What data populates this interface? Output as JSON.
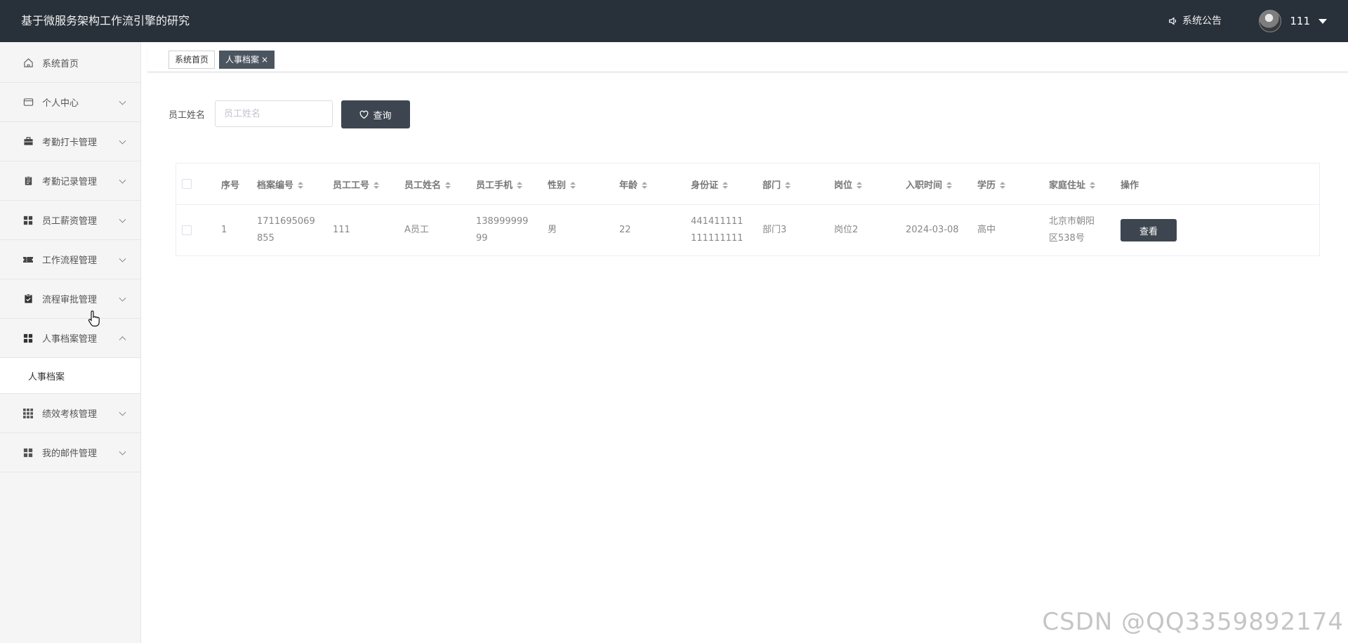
{
  "header": {
    "app_title": "基于微服务架构工作流引擎的研究",
    "notice_label": "系统公告",
    "username": "111"
  },
  "sidebar": {
    "items": [
      {
        "label": "系统首页",
        "icon": "home-icon"
      },
      {
        "label": "个人中心",
        "icon": "wallet-icon"
      },
      {
        "label": "考勤打卡管理",
        "icon": "briefcase-icon"
      },
      {
        "label": "考勤记录管理",
        "icon": "clipboard-icon"
      },
      {
        "label": "员工薪资管理",
        "icon": "grid-icon"
      },
      {
        "label": "工作流程管理",
        "icon": "ticket-icon"
      },
      {
        "label": "流程审批管理",
        "icon": "check-clipboard-icon"
      },
      {
        "label": "人事档案管理",
        "icon": "grid-icon"
      },
      {
        "label": "绩效考核管理",
        "icon": "apps-icon"
      },
      {
        "label": "我的邮件管理",
        "icon": "grid-icon"
      }
    ],
    "subitem": "人事档案"
  },
  "tabs": [
    {
      "label": "系统首页"
    },
    {
      "label": "人事档案",
      "close": "×"
    }
  ],
  "search": {
    "label": "员工姓名",
    "placeholder": "员工姓名",
    "button_label": "查询"
  },
  "table": {
    "headers": [
      "序号",
      "档案编号",
      "员工工号",
      "员工姓名",
      "员工手机",
      "性别",
      "年龄",
      "身份证",
      "部门",
      "岗位",
      "入职时间",
      "学历",
      "家庭住址",
      "操作"
    ],
    "rows": [
      {
        "index": "1",
        "archive_no_line1": "1711695069",
        "archive_no_line2": "855",
        "emp_no": "111",
        "emp_name": "A员工",
        "phone_line1": "138999999",
        "phone_line2": "99",
        "gender": "男",
        "age": "22",
        "id_line1": "441411111",
        "id_line2": "111111111",
        "dept": "部门3",
        "post": "岗位2",
        "hire_date": "2024-03-08",
        "education": "高中",
        "addr_line1": "北京市朝阳",
        "addr_line2": "区538号",
        "action": "查看"
      }
    ]
  },
  "watermark": "CSDN @QQ3359892174"
}
